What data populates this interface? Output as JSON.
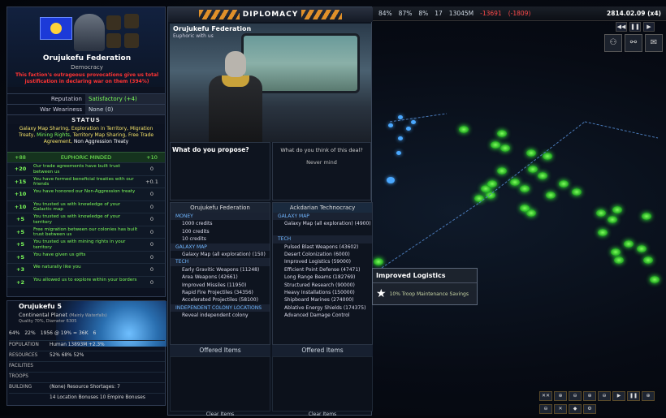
{
  "topbar": {
    "stat1": "84%",
    "stat2": "87%",
    "stat3": "8%",
    "stat4": "17",
    "stat5": "13045M",
    "credits": "-13691",
    "credits_change": "(-1809)",
    "date": "2814.02.09 (x4)"
  },
  "controls": {
    "rewind": "◀◀",
    "pause": "❚❚",
    "forward": "▶"
  },
  "icons": [
    "group-icon",
    "network-icon",
    "mail-icon"
  ],
  "faction": {
    "name": "Orujukefu Federation",
    "government": "Democracy",
    "warning": "This faction's outrageous provocations give us total justification in declaring war on them (394%)",
    "reputation_label": "Reputation",
    "reputation_value": "Satisfactory (+4)",
    "war_label": "War Weariness",
    "war_value": "None (0)",
    "status_label": "STATUS",
    "status_parts": [
      "Galaxy Map Sharing, ",
      "Exploration in Territory,",
      "Migration Treaty, ",
      "Mining Rights, ",
      "Territory Map Sharing,",
      "Free Trade Agreement, ",
      "Non Aggression Treaty"
    ],
    "mod_head_left": "+88",
    "mod_head_mid": "EUPHORIC MINDED",
    "mod_head_right": "+10",
    "modifiers": [
      {
        "n": "+20",
        "d": "Our trade agreements have built trust between us",
        "z": "0"
      },
      {
        "n": "+15",
        "d": "You have formed beneficial treaties with our friends",
        "z": "+0.1"
      },
      {
        "n": "+10",
        "d": "You have honored our Non-Aggression treaty",
        "z": "0"
      },
      {
        "n": "+10",
        "d": "You trusted us with knowledge of your Galactic map",
        "z": "0"
      },
      {
        "n": "+5",
        "d": "You trusted us with knowledge of your territory",
        "z": "0"
      },
      {
        "n": "+5",
        "d": "Free migration between our colonies has built trust between us",
        "z": "0"
      },
      {
        "n": "+5",
        "d": "You trusted us with mining rights in your territory",
        "z": "0"
      },
      {
        "n": "+5",
        "d": "You have given us gifts",
        "z": "0"
      },
      {
        "n": "+3",
        "d": "We naturally like you",
        "z": "0"
      },
      {
        "n": "+2",
        "d": "You allowed us to explore within your borders",
        "z": "0"
      }
    ]
  },
  "planet": {
    "name": "Orujukefu 5",
    "type": "Continental Planet",
    "type_note": "(Mainly Waterfalls)",
    "quality": "Quality 70%, Diameter 6305",
    "stats": [
      "64%",
      "22%",
      "1956 @ 19% = 36K",
      "6"
    ],
    "rows": [
      {
        "k": "POPULATION",
        "v": "Human    13893M    +2.3%"
      },
      {
        "k": "RESOURCES",
        "v": "52%    68%    52%"
      },
      {
        "k": "FACILITIES",
        "v": ""
      },
      {
        "k": "TROOPS",
        "v": ""
      },
      {
        "k": "BUILDING",
        "v": "(None)    Resource Shortages: 7"
      },
      {
        "k": "",
        "v": "14 Location Bonuses    10 Empire Bonuses"
      }
    ]
  },
  "diplomacy": {
    "title": "DIPLOMACY",
    "scene_name": "Orujukefu Federation",
    "scene_sub": "Euphoric with us",
    "propose": "What do you propose?",
    "response_q": "What do you think of this deal?",
    "never_mind": "Never mind",
    "left_head": "Orujukefu Federation",
    "right_head": "Ackdarian Technocracy",
    "left_items": [
      {
        "t": "cat",
        "v": "MONEY"
      },
      {
        "t": "it",
        "v": "1000 credits"
      },
      {
        "t": "it",
        "v": "100 credits"
      },
      {
        "t": "it",
        "v": "10 credits"
      },
      {
        "t": "cat",
        "v": "GALAXY MAP"
      },
      {
        "t": "it",
        "v": "Galaxy Map (all exploration) (150)"
      },
      {
        "t": "cat",
        "v": "TECH"
      },
      {
        "t": "it",
        "v": "Early Gravitic Weapons (11248)"
      },
      {
        "t": "it",
        "v": "Area Weapons (42661)"
      },
      {
        "t": "it",
        "v": "Improved Missiles (11950)"
      },
      {
        "t": "it",
        "v": "Rapid Fire Projectiles (34356)"
      },
      {
        "t": "it",
        "v": "Accelerated Projectiles (58100)"
      },
      {
        "t": "cat",
        "v": "INDEPENDENT COLONY LOCATIONS"
      },
      {
        "t": "it",
        "v": "Reveal independent colony"
      }
    ],
    "right_items": [
      {
        "t": "cat",
        "v": "GALAXY MAP"
      },
      {
        "t": "it",
        "v": "Galaxy Map (all exploration) (4900)"
      },
      {
        "t": "it",
        "v": ""
      },
      {
        "t": "cat",
        "v": "TECH"
      },
      {
        "t": "it",
        "v": "Pulsed Blast Weapons (43602)"
      },
      {
        "t": "it",
        "v": "Desert Colonization (6000)"
      },
      {
        "t": "it",
        "v": "Improved Logistics (59000)"
      },
      {
        "t": "it",
        "v": "Efficient Point Defense (47471)"
      },
      {
        "t": "it",
        "v": "Long Range Beams (182769)"
      },
      {
        "t": "it",
        "v": "Structured Research (90000)"
      },
      {
        "t": "it",
        "v": "Heavy Installations (150000)"
      },
      {
        "t": "it",
        "v": "Shipboard Marines (274000)"
      },
      {
        "t": "it",
        "v": "Ablative Energy Shields (174375)"
      },
      {
        "t": "it",
        "v": "Advanced Damage Control"
      }
    ],
    "offered_label": "Offered Items",
    "clear_label": "Clear Items"
  },
  "tooltip": {
    "title": "Improved Logistics",
    "body": "10% Troop Maintenance Savings"
  },
  "bottom_controls": [
    "✕✕",
    "⊕",
    "⊖",
    "⊕",
    "⊖",
    "▶",
    "❚❚",
    "⊕",
    "⊖",
    "✕",
    "◆",
    "⚙"
  ]
}
